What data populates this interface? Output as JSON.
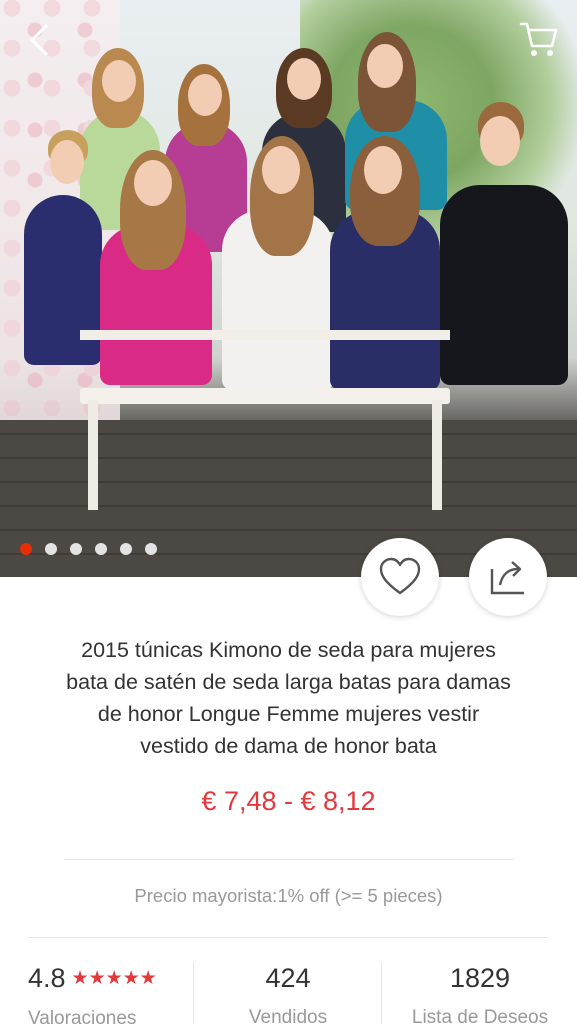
{
  "gallery": {
    "image_count": 6,
    "active_index": 0
  },
  "product": {
    "title_lines": [
      "2015 túnicas Kimono de seda para mujeres",
      "bata de satén de seda larga batas para damas",
      "de honor Longue Femme mujeres vestir",
      "vestido de dama de honor bata"
    ],
    "price": "€ 7,48 - € 8,12",
    "wholesale": "Precio mayorista:1% off (>= 5 pieces)"
  },
  "stats": {
    "rating": "4.8",
    "rating_stars": "★★★★★",
    "rating_label": "Valoraciones",
    "sold": "424",
    "sold_label": "Vendidos",
    "wishlist": "1829",
    "wishlist_label": "Lista de Deseos"
  },
  "colors": {
    "accent": "#e4393c",
    "active_dot": "#e62e04",
    "muted_text": "#999999"
  },
  "icons": {
    "back": "chevron-left-icon",
    "cart": "cart-icon",
    "favorite": "heart-icon",
    "share": "share-icon"
  }
}
